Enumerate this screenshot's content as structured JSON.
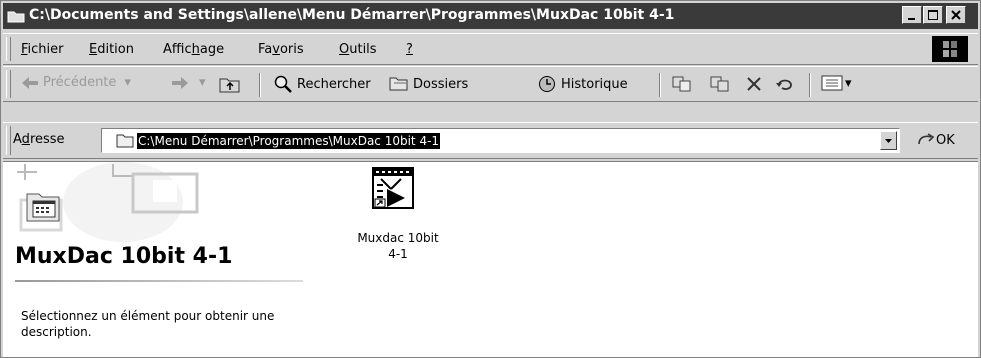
{
  "window": {
    "title": "C:\\Documents and Settings\\allene\\Menu Démarrer\\Programmes\\MuxDac 10bit 4-1"
  },
  "menu": {
    "fichier": {
      "accel": "F",
      "rest": "ichier"
    },
    "edition": {
      "accel": "E",
      "rest": "dition"
    },
    "affichage": {
      "pre": "Affic",
      "accel": "h",
      "post": "age"
    },
    "favoris": {
      "pre": "Fa",
      "accel": "v",
      "post": "oris"
    },
    "outils": {
      "accel": "O",
      "rest": "utils"
    },
    "aide": {
      "accel": "?"
    }
  },
  "toolbar": {
    "back_label": "Précédente",
    "search_label": "Rechercher",
    "folders_label": "Dossiers",
    "history_label": "Historique"
  },
  "address": {
    "label_pre": "A",
    "label_accel": "d",
    "label_post": "resse",
    "value": "C:\\Menu Démarrer\\Programmes\\MuxDac 10bit 4-1",
    "go_label": "OK"
  },
  "content": {
    "folder_title": "MuxDac 10bit 4-1",
    "description": "Sélectionnez un élément pour obtenir une description.",
    "files": [
      {
        "name_line1": "Muxdac 10bit",
        "name_line2": "4-1",
        "icon": "labview-shortcut-icon"
      }
    ]
  }
}
